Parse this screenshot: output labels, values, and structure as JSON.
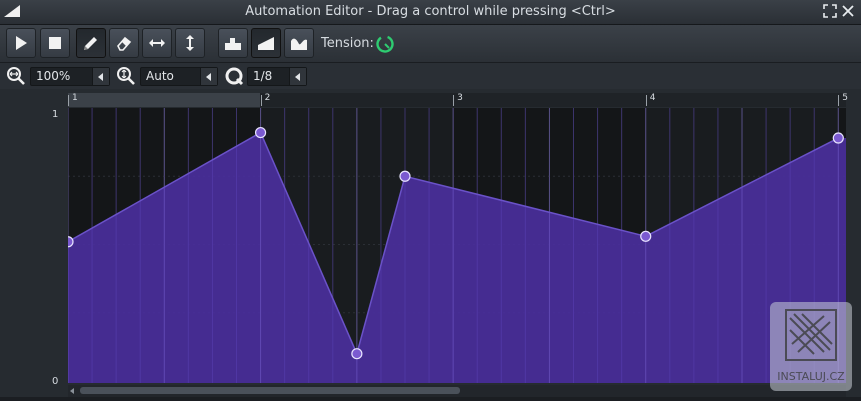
{
  "window": {
    "title": "Automation Editor - Drag a control while pressing <Ctrl>",
    "maximize_icon": "fullscreen-icon",
    "close_icon": "close-icon"
  },
  "toolbar": {
    "buttons": [
      {
        "name": "play",
        "icon": "play-icon",
        "active": false
      },
      {
        "name": "stop",
        "icon": "stop-icon",
        "active": false
      },
      {
        "name": "draw",
        "icon": "pencil-icon",
        "active": true
      },
      {
        "name": "erase",
        "icon": "eraser-icon",
        "active": false
      },
      {
        "name": "flip-x",
        "icon": "horizontal-arrows-icon",
        "active": false
      },
      {
        "name": "flip-y",
        "icon": "vertical-arrows-icon",
        "active": false
      },
      {
        "name": "discrete",
        "icon": "discrete-progression-icon",
        "active": false
      },
      {
        "name": "linear",
        "icon": "linear-progression-icon",
        "active": true
      },
      {
        "name": "cubic",
        "icon": "cubic-hermite-icon",
        "active": false
      }
    ],
    "tension_label": "Tension:",
    "tension_color": "#2ecc71"
  },
  "zoom": {
    "horizontal": "100%",
    "vertical": "Auto",
    "quantize": "1/8"
  },
  "ruler": {
    "bars": [
      "1",
      "2",
      "3",
      "4",
      "5"
    ]
  },
  "graph": {
    "y_max_label": "1",
    "y_min_label": "0",
    "fill_color": "#4a2f9c",
    "point_color": "#7b5ad0",
    "background": "#141618",
    "points": [
      {
        "bar": 1.0,
        "value": 0.51
      },
      {
        "bar": 2.0,
        "value": 0.91
      },
      {
        "bar": 2.5,
        "value": 0.1
      },
      {
        "bar": 2.75,
        "value": 0.75
      },
      {
        "bar": 4.0,
        "value": 0.53
      },
      {
        "bar": 5.0,
        "value": 0.89
      }
    ],
    "visible_bars": [
      1,
      5.04
    ]
  },
  "watermark": {
    "text": "INSTALUJ.CZ"
  }
}
